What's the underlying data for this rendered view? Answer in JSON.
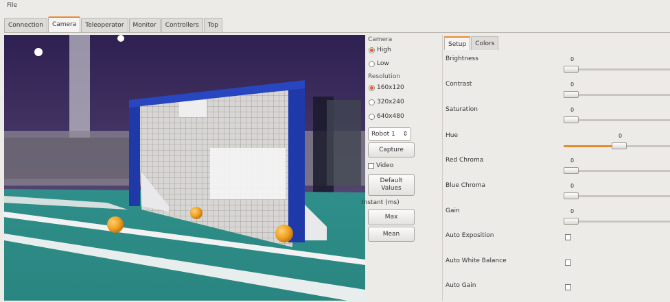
{
  "menu": {
    "file": "File"
  },
  "tabs": [
    {
      "label": "Connection",
      "active": false
    },
    {
      "label": "Camera",
      "active": true
    },
    {
      "label": "Teleoperator",
      "active": false
    },
    {
      "label": "Monitor",
      "active": false
    },
    {
      "label": "Controllers",
      "active": false
    },
    {
      "label": "Top",
      "active": false
    }
  ],
  "camera": {
    "group_label": "Camera",
    "high": "High",
    "low": "Low",
    "selected": "High",
    "resolution_label": "Resolution",
    "res_160": "160x120",
    "res_320": "320x240",
    "res_640": "640x480",
    "selected_resolution": "160x120",
    "robot_select": "Robot 1",
    "spin_arrows": "⇕",
    "capture": "Capture",
    "video": "Video",
    "default_line1": "Default",
    "default_line2": "Values",
    "instant_label": "Instant (ms)",
    "max": "Max",
    "mean": "Mean"
  },
  "settings": {
    "tab_setup": "Setup",
    "tab_colors": "Colors",
    "sliders": [
      {
        "label": "Brightness",
        "value": "0",
        "level": 0
      },
      {
        "label": "Contrast",
        "value": "0",
        "level": 0
      },
      {
        "label": "Saturation",
        "value": "0",
        "level": 0
      },
      {
        "label": "Hue",
        "value": "0",
        "level": 0.5
      },
      {
        "label": "Red Chroma",
        "value": "0",
        "level": 0
      },
      {
        "label": "Blue Chroma",
        "value": "0",
        "level": 0
      },
      {
        "label": "Gain",
        "value": "0",
        "level": 0
      }
    ],
    "checks": [
      {
        "label": "Auto Exposition",
        "checked": false
      },
      {
        "label": "Auto White Balance",
        "checked": false
      },
      {
        "label": "Auto Gain",
        "checked": false
      }
    ]
  },
  "colors": {
    "accent": "#e88a2e",
    "radio_on": "#e0552a"
  }
}
